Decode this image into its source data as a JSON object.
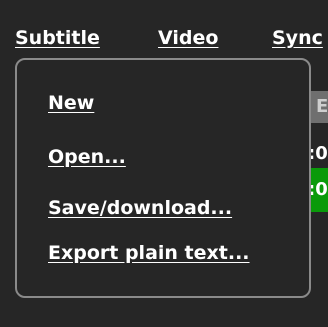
{
  "menubar": {
    "items": [
      {
        "label": "Subtitle"
      },
      {
        "label": "Video"
      },
      {
        "label": "Sync"
      }
    ]
  },
  "subtitle_menu": {
    "items": [
      {
        "label": "New"
      },
      {
        "label": "Open..."
      },
      {
        "label": "Save/download..."
      },
      {
        "label": "Export plain text..."
      }
    ]
  },
  "background": {
    "header_fragment": "E",
    "row1_fragment": ":0",
    "row2_fragment": ":0"
  },
  "colors": {
    "background": "#262626",
    "menu_border": "#8a8a8a",
    "text": "#ffffff",
    "selected_row": "#0a9a0a",
    "header_cell": "#6f6f6f"
  }
}
